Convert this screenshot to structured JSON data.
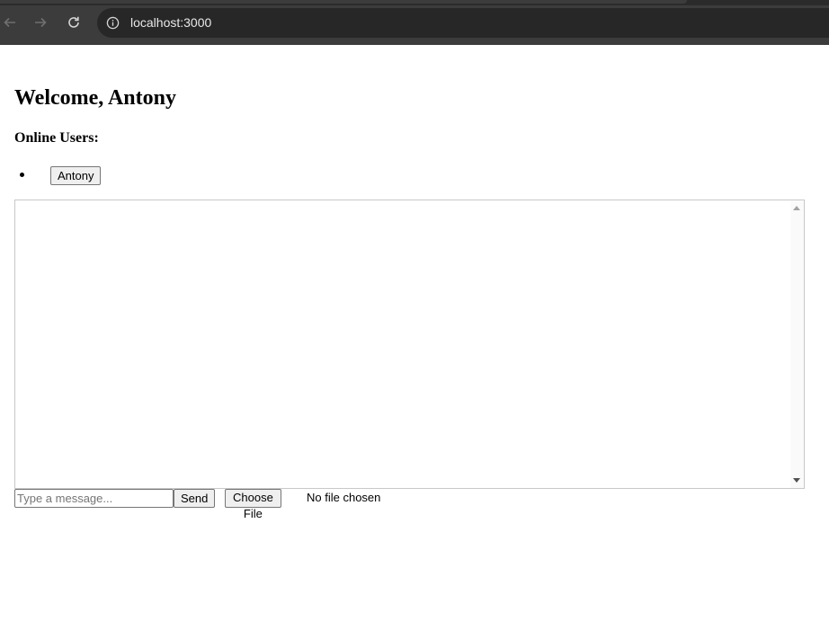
{
  "browser": {
    "url": "localhost:3000",
    "icons": {
      "back": "arrow-left-icon",
      "forward": "arrow-right-icon",
      "reload": "reload-icon",
      "site_info": "info-icon"
    }
  },
  "page": {
    "welcome_heading": "Welcome, Antony",
    "online_users_heading": "Online Users:",
    "online_users": [
      "Antony"
    ]
  },
  "composer": {
    "message_placeholder": "Type a message...",
    "message_value": "",
    "send_label": "Send",
    "choose_file_label": "Choose File",
    "file_status": "No file chosen"
  }
}
